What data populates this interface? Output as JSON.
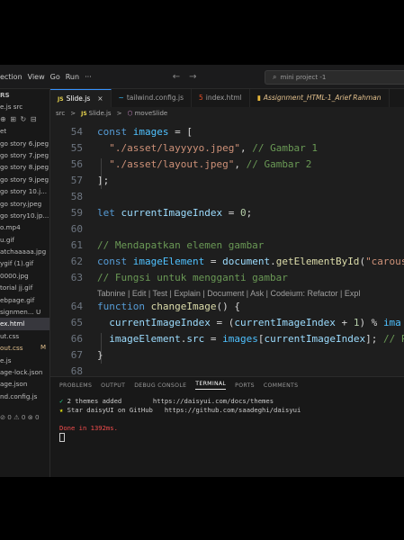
{
  "menu": {
    "items": [
      "ection",
      "View",
      "Go",
      "Run"
    ],
    "more": "···",
    "back": "←",
    "forward": "→",
    "search": "mini project -1"
  },
  "sidebar": {
    "header": "RS",
    "file_top": "e.js src",
    "icons": "⊕ ⊞ ↻ ⊟",
    "section": "et",
    "items": [
      {
        "label": "go story 6.jpeg"
      },
      {
        "label": "go story 7.jpeg"
      },
      {
        "label": "go story 8.jpeg"
      },
      {
        "label": "go story 9.jpeg"
      },
      {
        "label": "go story 10.j..."
      },
      {
        "label": "go story.jpeg"
      },
      {
        "label": "go story10.jp..."
      },
      {
        "label": "o.mp4"
      },
      {
        "label": "u.gif"
      },
      {
        "label": "atchaaaaa.jpg"
      },
      {
        "label": "ygif (1).gif"
      },
      {
        "label": "0000.jpg"
      },
      {
        "label": "torial jj.gif"
      },
      {
        "label": "ebpage.gif"
      },
      {
        "label": "signmen... U"
      },
      {
        "label": "ex.html"
      },
      {
        "label": "ut.css"
      },
      {
        "label": "out.css",
        "badge": "M"
      },
      {
        "label": "e.js"
      },
      {
        "label": "age-lock.json"
      },
      {
        "label": "age.json"
      },
      {
        "label": "nd.config.js"
      }
    ],
    "footer": "⊘ 0 ⚠ 0  ⊗ 0"
  },
  "tabs": [
    {
      "icon": "JS",
      "label": "Slide.js",
      "close": "×",
      "active": true
    },
    {
      "icon": "~",
      "label": "tailwind.config.js"
    },
    {
      "icon": "5",
      "label": "index.html"
    },
    {
      "icon": "▮",
      "label": "Assignment_HTML-1_Arief Rahman"
    }
  ],
  "breadcrumb": {
    "folder": "src",
    "sep": ">",
    "file": "Slide.js",
    "symbol": "moveSlide"
  },
  "editor": {
    "line_numbers": [
      "54",
      "55",
      "56",
      "57",
      "58",
      "59",
      "60",
      "61",
      "62",
      "63",
      "64",
      "65",
      "66",
      "67",
      "68"
    ],
    "lens": "Tabnine | Edit | Test | Explain | Document | Ask | Codeium: Refactor | Expl"
  },
  "panel": {
    "tabs": [
      "PROBLEMS",
      "OUTPUT",
      "DEBUG CONSOLE",
      "TERMINAL",
      "PORTS",
      "COMMENTS"
    ],
    "terminal": [
      {
        "check": "✓",
        "text": "2 themes added",
        "url": "https://daisyui.com/docs/themes"
      },
      {
        "check": "★",
        "text": "Star daisyUI on GitHub",
        "url": "https://github.com/saadeghi/daisyui"
      }
    ],
    "done": "Done in 1392ms."
  }
}
